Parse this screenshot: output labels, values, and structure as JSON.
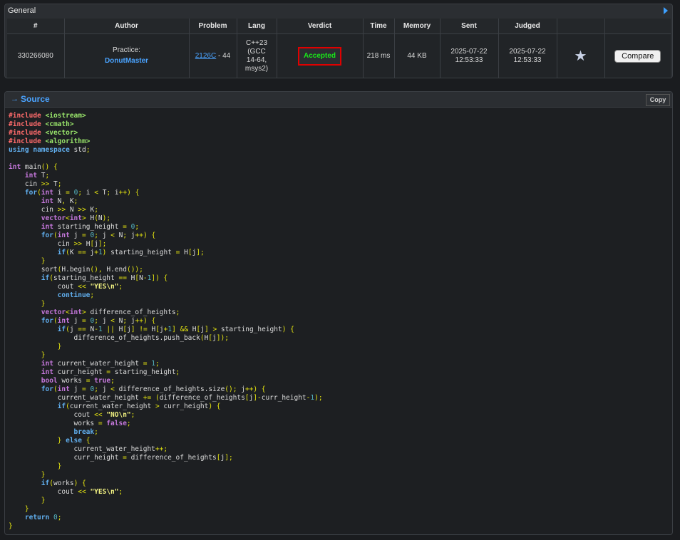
{
  "general": {
    "title": "General",
    "columns": [
      "#",
      "Author",
      "Problem",
      "Lang",
      "Verdict",
      "Time",
      "Memory",
      "Sent",
      "Judged",
      "",
      ""
    ],
    "row": {
      "id": "330266080",
      "author_prefix": "Practice:",
      "author_name": "DonutMaster",
      "problem_link": "2126C",
      "problem_suffix": " - 44",
      "lang_lines": [
        "C++23",
        "(GCC",
        "14-64,",
        "msys2)"
      ],
      "verdict": "Accepted",
      "time": "218 ms",
      "memory": "44 KB",
      "sent_date": "2025-07-22",
      "sent_time": "12:53:33",
      "judged_date": "2025-07-22",
      "judged_time": "12:53:33",
      "favorite_icon": "star-icon",
      "compare_label": "Compare"
    }
  },
  "source": {
    "title": "Source",
    "copy_label": "Copy",
    "lines": [
      "#include <iostream>",
      "#include <cmath>",
      "#include <vector>",
      "#include <algorithm>",
      "using namespace std;",
      "",
      "int main() {",
      "    int T;",
      "    cin >> T;",
      "    for(int i = 0; i < T; i++) {",
      "        int N, K;",
      "        cin >> N >> K;",
      "        vector<int> H(N);",
      "        int starting_height = 0;",
      "        for(int j = 0; j < N; j++) {",
      "            cin >> H[j];",
      "            if(K == j+1) starting_height = H[j];",
      "        }",
      "        sort(H.begin(), H.end());",
      "        if(starting_height == H[N-1]) {",
      "            cout << \"YES\\n\";",
      "            continue;",
      "        }",
      "        vector<int> difference_of_heights;",
      "        for(int j = 0; j < N; j++) {",
      "            if(j == N-1 || H[j] != H[j+1] && H[j] > starting_height) {",
      "                difference_of_heights.push_back(H[j]);",
      "            }",
      "        }",
      "        int current_water_height = 1;",
      "        int curr_height = starting_height;",
      "        bool works = true;",
      "        for(int j = 0; j < difference_of_heights.size(); j++) {",
      "            current_water_height += (difference_of_heights[j]-curr_height-1);",
      "            if(current_water_height > curr_height) {",
      "                cout << \"NO\\n\";",
      "                works = false;",
      "                break;",
      "            } else {",
      "                current_water_height++;",
      "                curr_height = difference_of_heights[j];",
      "            }",
      "        }",
      "        if(works) {",
      "            cout << \"YES\\n\";",
      "        }",
      "    }",
      "    return 0;",
      "}"
    ]
  },
  "colors": {
    "accent": "#4aa3ff",
    "verdict_ok": "#19e619",
    "highlight_border": "#e00000"
  }
}
